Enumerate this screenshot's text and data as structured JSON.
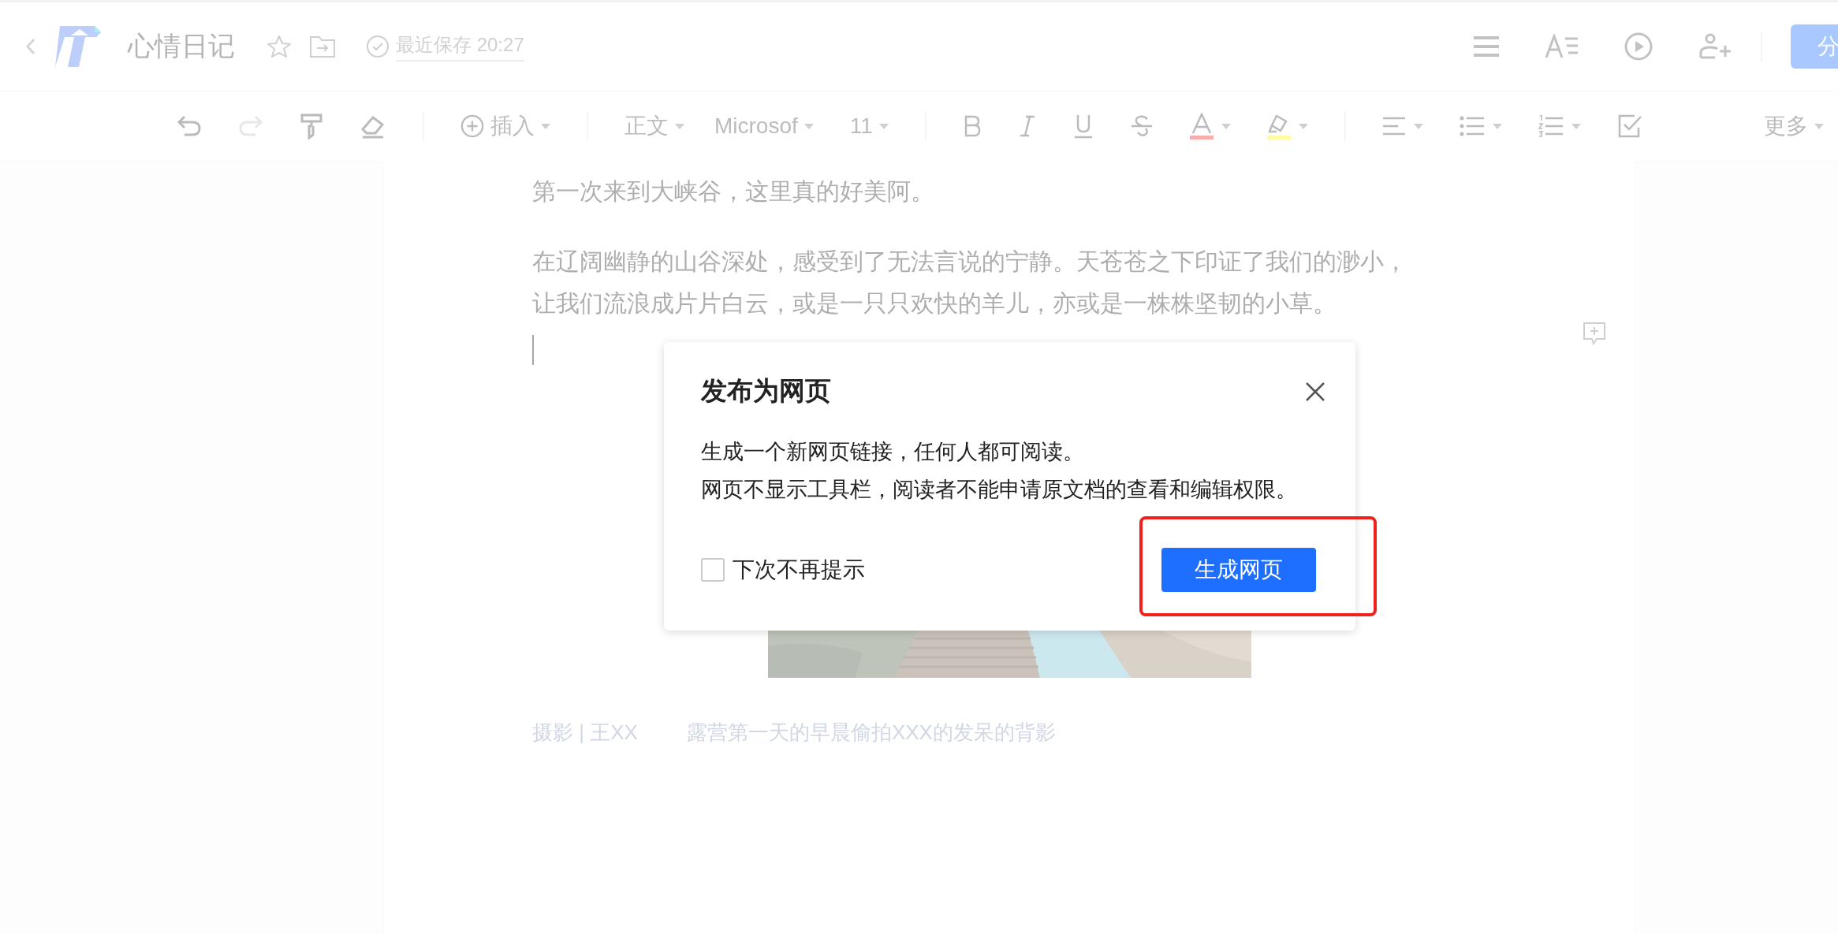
{
  "topbar": {
    "title": "心情日记",
    "save_status": "最近保存 20:27",
    "share_button": "分"
  },
  "toolbar": {
    "undo": {
      "disabled": false
    },
    "redo": {
      "disabled": true
    },
    "insert": "插入",
    "style": "正文",
    "font": "Microsof",
    "size": "11",
    "more": "更多"
  },
  "document": {
    "paragraphs": [
      {
        "lines": [
          "第一次来到大峡谷，这里真的好美阿。"
        ]
      },
      {
        "lines": [
          "在辽阔幽静的山谷深处，感受到了无法言说的宁静。天苍苍之下印证了我们的渺小，",
          "让我们流浪成片片白云，或是一只只欢快的羊儿，亦或是一株株坚韧的小草。"
        ]
      }
    ],
    "caption": {
      "credit": "摄影 | 王XX",
      "text": "露营第一天的早晨偷拍XXX的发呆的背影"
    }
  },
  "dialog": {
    "title": "发布为网页",
    "lines": [
      "生成一个新网页链接，任何人都可阅读。",
      "网页不显示工具栏，阅读者不能申请原文档的查看和编辑权限。"
    ],
    "checkbox": {
      "label": "下次不再提示",
      "checked": false
    },
    "primary_button": "生成网页"
  }
}
